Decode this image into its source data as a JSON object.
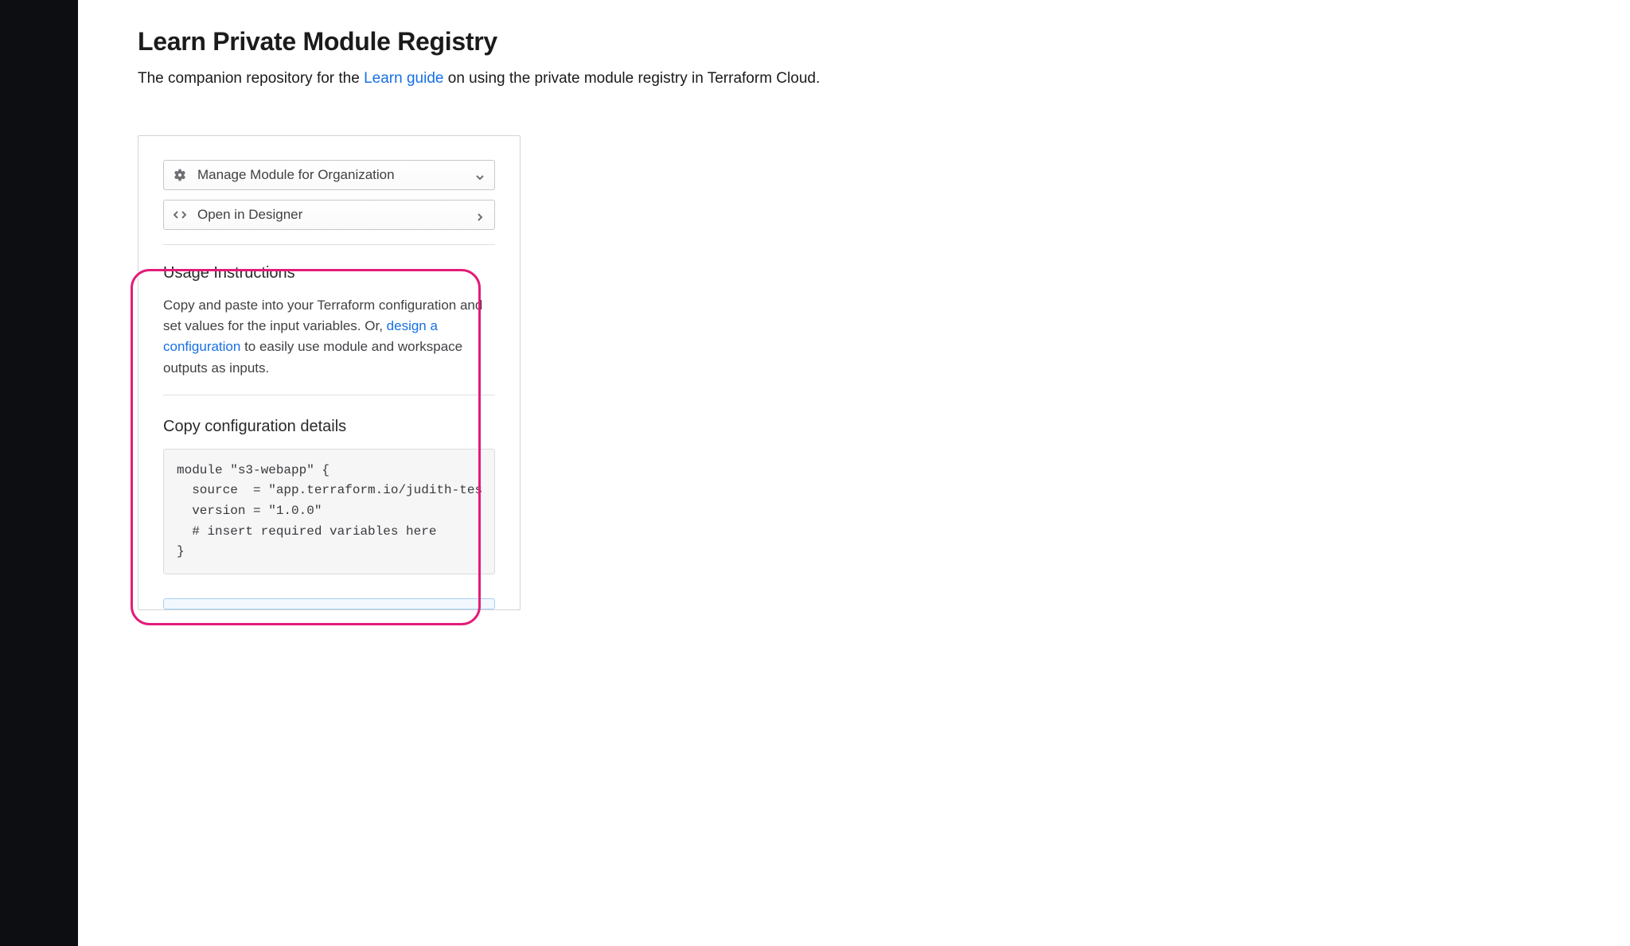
{
  "page": {
    "title": "Learn Private Module Registry",
    "intro_before": "The companion repository for the ",
    "intro_link": "Learn guide",
    "intro_after": " on using the private module registry in Terraform Cloud."
  },
  "card": {
    "manage_button": "Manage Module for Organization",
    "designer_button": "Open in Designer",
    "usage_heading": "Usage Instructions",
    "usage_text_before": "Copy and paste into your Terraform configuration and set values for the input variables. Or, ",
    "usage_link": "design a configuration",
    "usage_text_after": " to easily use module and workspace outputs as inputs.",
    "config_heading": "Copy configuration details",
    "code": "module \"s3-webapp\" {\n  source  = \"app.terraform.io/judith-tes\n  version = \"1.0.0\"\n  # insert required variables here\n}"
  }
}
